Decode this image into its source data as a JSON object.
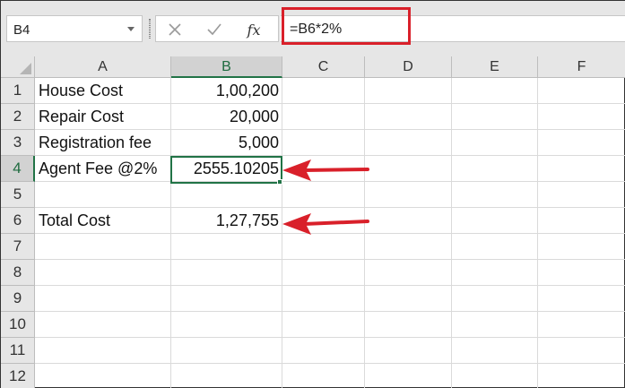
{
  "name_box": {
    "value": "B4"
  },
  "formula_bar": {
    "cancel_icon": "close-icon",
    "enter_icon": "check-icon",
    "function_label": "fx",
    "formula": "=B6*2%"
  },
  "columns": [
    "A",
    "B",
    "C",
    "D",
    "E",
    "F"
  ],
  "rows": [
    "1",
    "2",
    "3",
    "4",
    "5",
    "6",
    "7",
    "8",
    "9",
    "10",
    "11",
    "12"
  ],
  "selected_column": "B",
  "selected_row": "4",
  "cells": {
    "A1": "House Cost",
    "B1": "1,00,200",
    "A2": "Repair Cost",
    "B2": "20,000",
    "A3": "Registration fee",
    "B3": "5,000",
    "A4": "Agent Fee @2%",
    "B4": "2555.10205",
    "A6": "Total Cost",
    "B6": "1,27,755"
  },
  "colors": {
    "highlight": "#d9202a",
    "selection": "#217346"
  }
}
